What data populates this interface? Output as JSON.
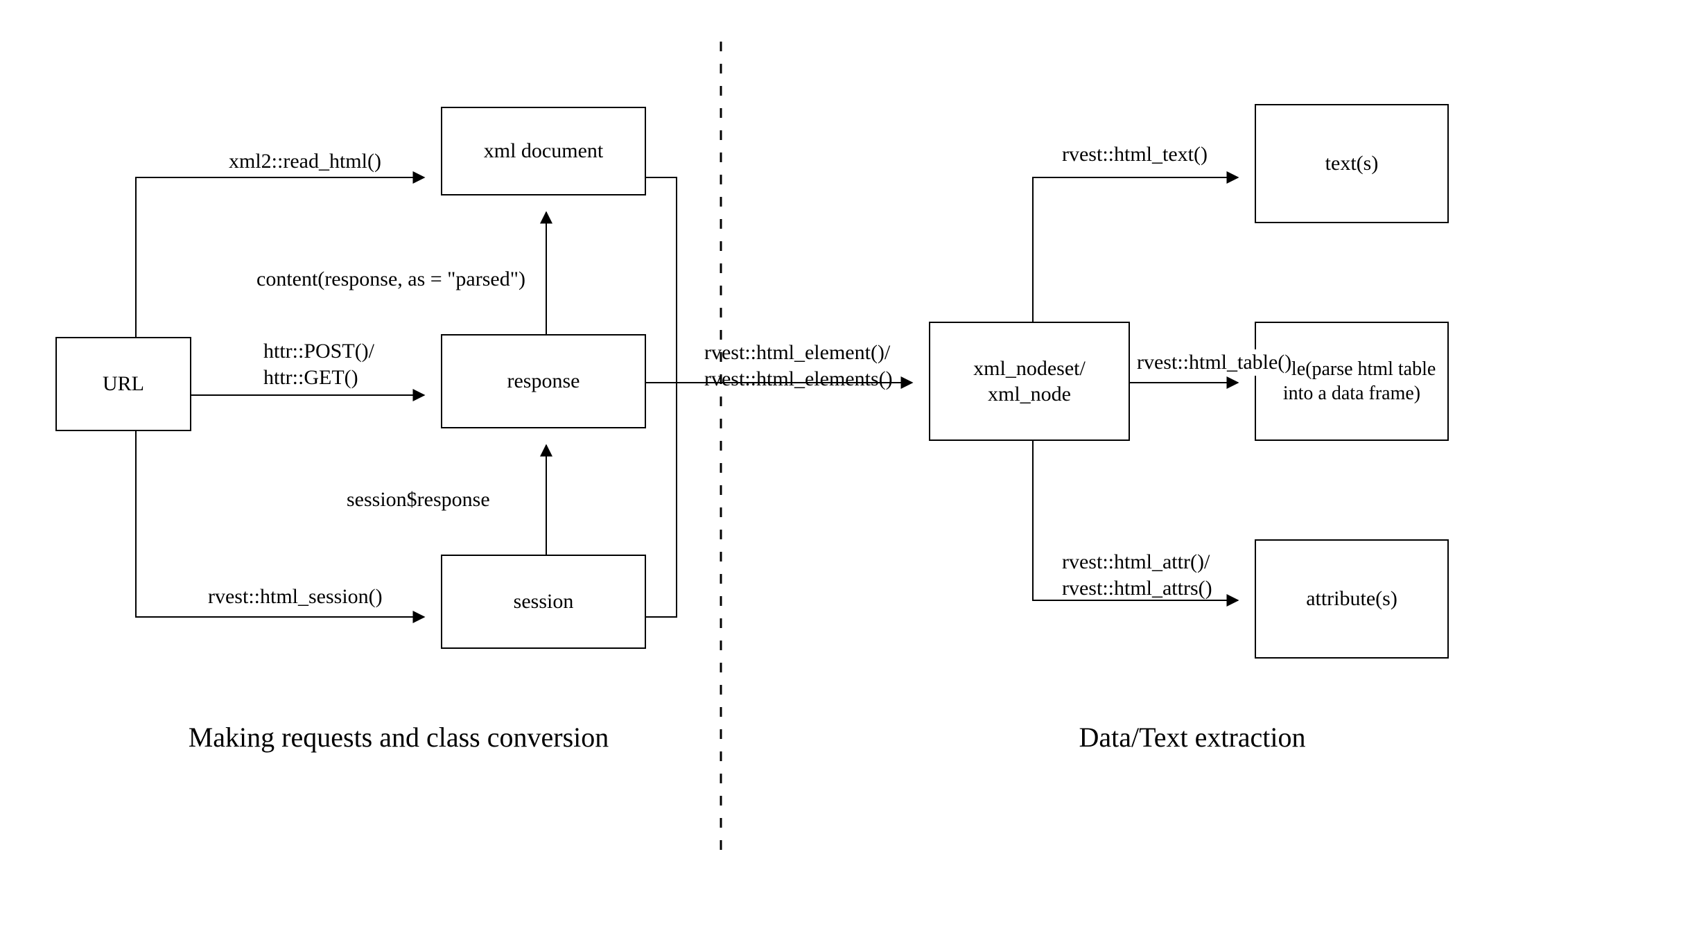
{
  "nodes": {
    "url": "URL",
    "xml_document": "xml document",
    "response": "response",
    "session": "session",
    "xml_nodeset": "xml_nodeset/\nxml_node",
    "text": "text(s)",
    "table": "table(parse html\ntable into a data\nframe)",
    "attribute": "attribute(s)"
  },
  "edges": {
    "read_html": "xml2::read_html()",
    "content_parsed": "content(response, as = \"parsed\")",
    "httr": "httr::POST()/\nhttr::GET()",
    "session_response": "session$response",
    "html_session": "rvest::html_session()",
    "html_element": "rvest::html_element()/\nrvest::html_elements()",
    "html_text": "rvest::html_text()",
    "html_table": "rvest::html_table()",
    "html_attr": "rvest::html_attr()/\nrvest::html_attrs()"
  },
  "sections": {
    "left": "Making requests and class conversion",
    "right": "Data/Text extraction"
  }
}
